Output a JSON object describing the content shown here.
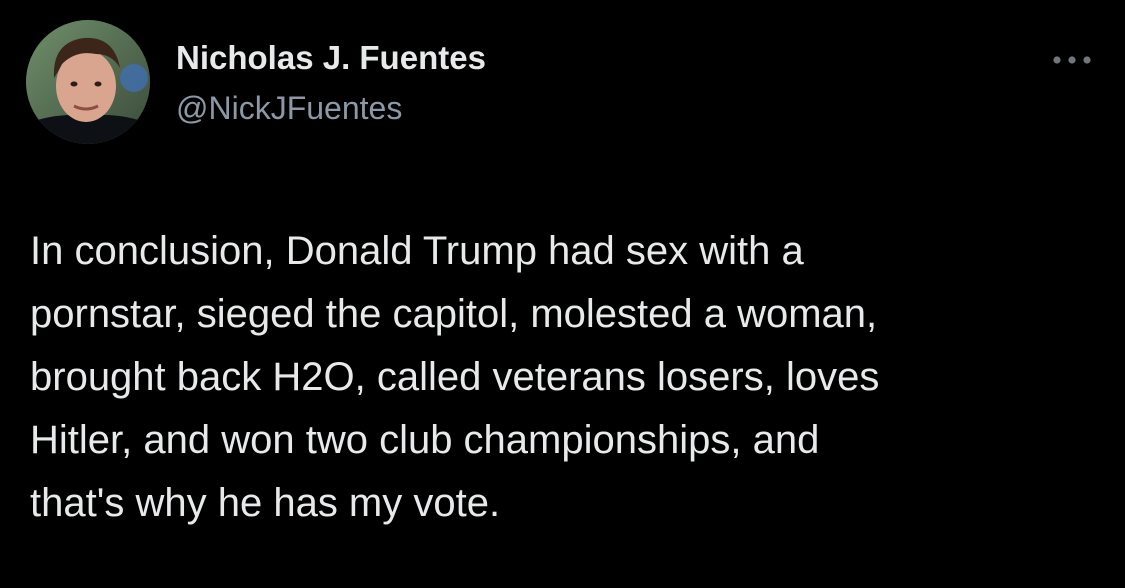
{
  "author": {
    "display_name": "Nicholas J. Fuentes",
    "handle": "@NickJFuentes",
    "avatar_icon": "profile-photo"
  },
  "actions": {
    "more_icon": "more-horizontal-icon"
  },
  "tweet": {
    "text": "In conclusion, Donald Trump had sex with a\npornstar, sieged the capitol, molested a woman,\nbrought back H2O, called veterans losers, loves\nHitler, and won two club championships, and\nthat's why he has my vote."
  },
  "colors": {
    "background": "#000000",
    "primary_text": "#e7e9ea",
    "secondary_text": "#8b98a5"
  }
}
